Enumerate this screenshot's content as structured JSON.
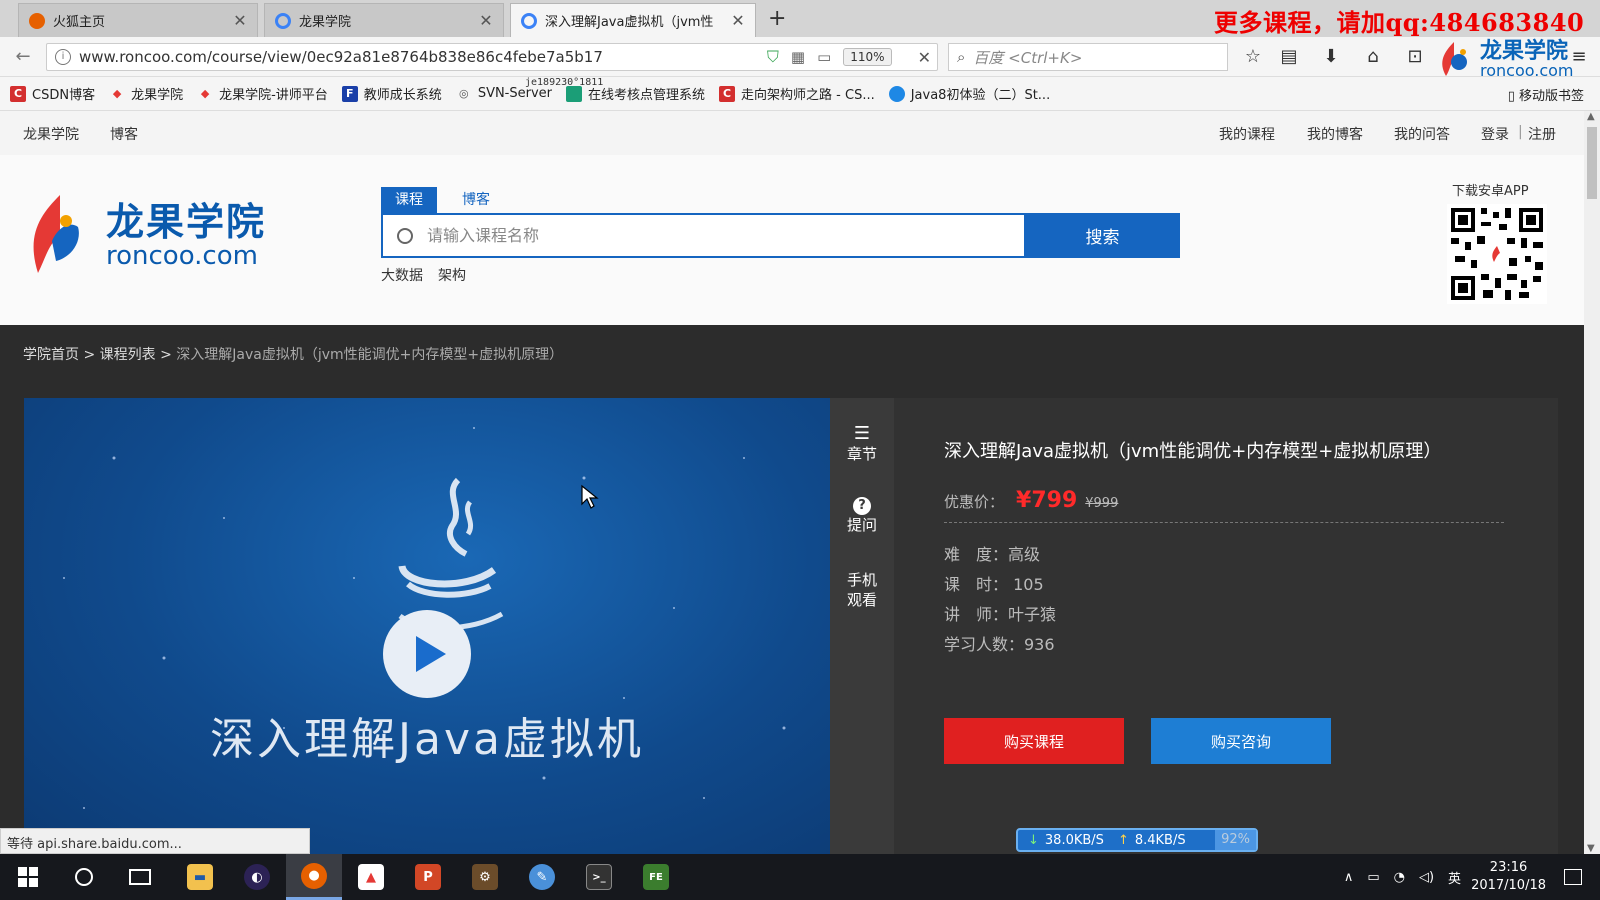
{
  "browser": {
    "tabs": [
      {
        "title": "火狐主页",
        "active": false,
        "favicon_color": "#e66000"
      },
      {
        "title": "龙果学院",
        "active": false,
        "favicon_color": "#3b82f6"
      },
      {
        "title": "深入理解Java虚拟机（jvm性",
        "active": true,
        "favicon_color": "#3b82f6"
      }
    ],
    "new_tab": "+",
    "promo_banner": "更多课程，请加qq:484683840",
    "url": "www.roncoo.com/course/view/0ec92a81e8764b838e86c4febe7a5b17",
    "zoom": "110%",
    "search_placeholder": "百度 <Ctrl+K>",
    "toolbar_logo": {
      "name": "龙果学院",
      "domain": "roncoo.com"
    },
    "bookmarks": [
      {
        "label": "CSDN博客",
        "icon": "C",
        "color": "#d32f2f"
      },
      {
        "label": "龙果学院",
        "icon": "◆",
        "color": "#e53935"
      },
      {
        "label": "龙果学院-讲师平台",
        "icon": "◆",
        "color": "#e53935"
      },
      {
        "label": "教师成长系统",
        "icon": "F",
        "color": "#1a3fa8"
      },
      {
        "label": "SVN-Server",
        "icon": "◎",
        "color": "#555555"
      },
      {
        "label": "在线考核点管理系统",
        "icon": "■",
        "color": "#1b9e77"
      },
      {
        "label": "走向架构师之路 - CS...",
        "icon": "C",
        "color": "#d32f2f"
      },
      {
        "label": "Java8初体验（二）St...",
        "icon": "◉",
        "color": "#1e88e5"
      }
    ],
    "bookmark_overlay_text": "je189230°1811",
    "mobile_bookmarks": "移动版书签",
    "status_text": "等待 api.share.baidu.com..."
  },
  "site": {
    "topnav_left": [
      "龙果学院",
      "博客"
    ],
    "topnav_right": [
      "我的课程",
      "我的博客",
      "我的问答",
      "登录",
      "|",
      "注册"
    ],
    "logo": {
      "name": "龙果学院",
      "domain": "roncoo.com"
    },
    "search": {
      "tabs": [
        "课程",
        "博客"
      ],
      "placeholder": "请输入课程名称",
      "button": "搜索",
      "hot_keywords": [
        "大数据",
        "架构"
      ]
    },
    "app_download": "下载安卓APP",
    "breadcrumb": {
      "home": "学院首页",
      "sep": ">",
      "list": "课程列表",
      "current": "深入理解Java虚拟机（jvm性能调优+内存模型+虚拟机原理）"
    },
    "player": {
      "video_title": "深入理解Java虚拟机"
    },
    "rail": [
      {
        "icon": "list-icon",
        "label": "章节"
      },
      {
        "icon": "question-icon",
        "label": "提问"
      },
      {
        "icon": "",
        "label": "手机观看"
      }
    ],
    "course": {
      "title": "深入理解Java虚拟机（jvm性能调优+内存模型+虚拟机原理）",
      "price_label": "优惠价：",
      "price": "¥799",
      "price_original": "¥999",
      "difficulty": "难　度：高级",
      "lessons": "课　时：  105",
      "teacher": "讲　师：叶子猿",
      "students": "学习人数：936",
      "buy_button": "购买课程",
      "consult_button": "购买咨询"
    }
  },
  "netspeed": {
    "down": "38.0KB/S",
    "up": "8.4KB/S",
    "percent": "92%"
  },
  "taskbar": {
    "apps": [
      {
        "name": "file-explorer",
        "glyph": "▬",
        "color": "#f2c14e"
      },
      {
        "name": "eclipse",
        "glyph": "◐",
        "color": "#2c2255"
      },
      {
        "name": "firefox",
        "glyph": "●",
        "color": "#e66000"
      },
      {
        "name": "media-app",
        "glyph": "▲",
        "color": "#e53935"
      },
      {
        "name": "powerpoint",
        "glyph": "P",
        "color": "#d24726"
      },
      {
        "name": "app-gear",
        "glyph": "⚙",
        "color": "#6b4c2a"
      },
      {
        "name": "paint-app",
        "glyph": "✎",
        "color": "#4a90d9"
      },
      {
        "name": "terminal",
        "glyph": ">_",
        "color": "#333333"
      },
      {
        "name": "app-fen",
        "glyph": "FE",
        "color": "#3b7d2e"
      }
    ],
    "ime": "英",
    "time": "23:16",
    "date": "2017/10/18"
  }
}
